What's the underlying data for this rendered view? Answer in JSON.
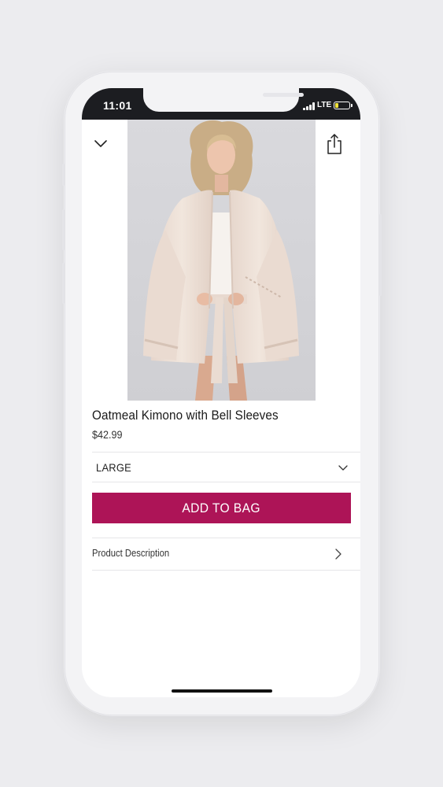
{
  "status_bar": {
    "time": "11:01",
    "network": "LTE"
  },
  "product": {
    "image_alt": "Model wearing oatmeal kimono with bell sleeves",
    "title": "Oatmeal Kimono with Bell Sleeves",
    "price": "$42.99"
  },
  "size_selector": {
    "selected": "LARGE"
  },
  "actions": {
    "add_to_bag": "ADD TO BAG"
  },
  "sections": {
    "description_label": "Product Description"
  },
  "icons": {
    "close": "chevron-down-icon",
    "share": "share-icon",
    "dropdown": "chevron-down-icon",
    "disclosure": "chevron-right-icon"
  },
  "colors": {
    "accent": "#ad1457",
    "status_bar": "#1c1d21",
    "battery": "#f1e33a"
  }
}
